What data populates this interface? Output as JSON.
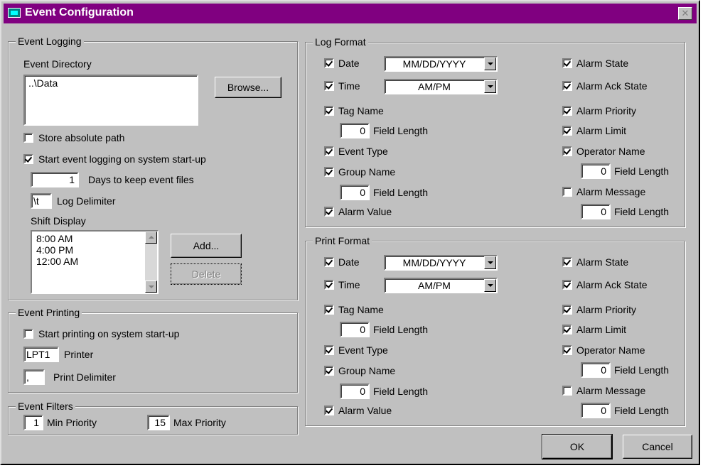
{
  "window": {
    "title": "Event Configuration",
    "close_icon": "close-icon"
  },
  "event_logging": {
    "legend": "Event Logging",
    "directory_label": "Event Directory",
    "directory_value": "..\\Data",
    "browse_button": "Browse...",
    "store_absolute_path": {
      "label": "Store absolute path",
      "checked": false
    },
    "start_on_startup": {
      "label": "Start event logging on system start-up",
      "checked": true
    },
    "days_value": "1",
    "days_label": "Days to keep event files",
    "delimiter_value": "\\t",
    "delimiter_label": "Log Delimiter",
    "shift_display_label": "Shift Display",
    "shifts": [
      "8:00 AM",
      "4:00 PM",
      "12:00 AM"
    ],
    "add_button": "Add...",
    "delete_button": "Delete"
  },
  "event_printing": {
    "legend": "Event Printing",
    "start_on_startup": {
      "label": "Start printing on system start-up",
      "checked": false
    },
    "printer_value": "LPT1",
    "printer_label": "Printer",
    "delimiter_value": ",",
    "delimiter_label": "Print Delimiter"
  },
  "event_filters": {
    "legend": "Event Filters",
    "min_value": "1",
    "min_label": "Min Priority",
    "max_value": "15",
    "max_label": "Max Priority"
  },
  "log_format": {
    "legend": "Log Format",
    "date_label": "Date",
    "date_format": "MM/DD/YYYY",
    "time_label": "Time",
    "time_format": "AM/PM",
    "tag_name_label": "Tag Name",
    "tag_field_length": "0",
    "field_length_label": "Field Length",
    "event_type_label": "Event Type",
    "group_name_label": "Group Name",
    "group_field_length": "0",
    "alarm_value_label": "Alarm Value",
    "alarm_state_label": "Alarm State",
    "alarm_ack_state_label": "Alarm Ack State",
    "alarm_priority_label": "Alarm Priority",
    "alarm_limit_label": "Alarm Limit",
    "operator_name_label": "Operator Name",
    "operator_field_length": "0",
    "alarm_message_label": "Alarm Message",
    "message_field_length": "0"
  },
  "print_format": {
    "legend": "Print Format",
    "date_label": "Date",
    "date_format": "MM/DD/YYYY",
    "time_label": "Time",
    "time_format": "AM/PM",
    "tag_name_label": "Tag Name",
    "tag_field_length": "0",
    "field_length_label": "Field Length",
    "event_type_label": "Event Type",
    "group_name_label": "Group Name",
    "group_field_length": "0",
    "alarm_value_label": "Alarm Value",
    "alarm_state_label": "Alarm State",
    "alarm_ack_state_label": "Alarm Ack State",
    "alarm_priority_label": "Alarm Priority",
    "alarm_limit_label": "Alarm Limit",
    "operator_name_label": "Operator Name",
    "operator_field_length": "0",
    "alarm_message_label": "Alarm Message",
    "message_field_length": "0"
  },
  "footer": {
    "ok_button": "OK",
    "cancel_button": "Cancel"
  }
}
